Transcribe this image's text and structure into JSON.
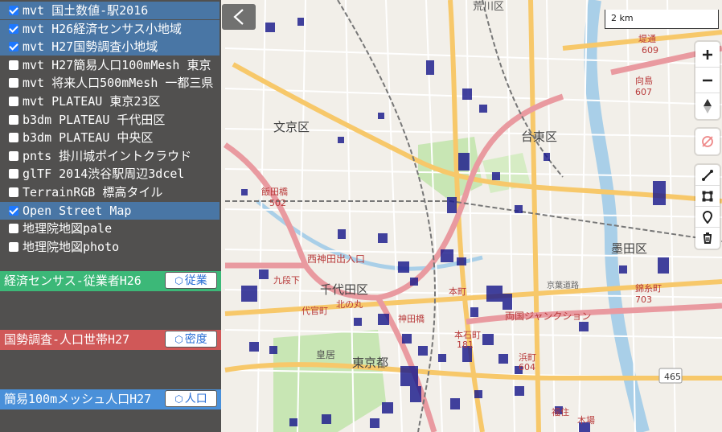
{
  "layers": [
    {
      "label": "mvt  国土数値-駅2016",
      "checked": true,
      "highlighted": true
    },
    {
      "label": "mvt  H26経済センサス小地域",
      "checked": true,
      "highlighted": true
    },
    {
      "label": "mvt  H27国勢調査小地域",
      "checked": true,
      "highlighted": true
    },
    {
      "label": "mvt  H27簡易人口100mMesh 東京",
      "checked": false,
      "highlighted": false
    },
    {
      "label": "mvt  将来人口500mMesh 一都三県",
      "checked": false,
      "highlighted": false
    },
    {
      "label": "mvt  PLATEAU 東京23区",
      "checked": false,
      "highlighted": false
    },
    {
      "label": "b3dm PLATEAU 千代田区",
      "checked": false,
      "highlighted": false
    },
    {
      "label": "b3dm PLATEAU 中央区",
      "checked": false,
      "highlighted": false
    },
    {
      "label": "pnts 掛川城ポイントクラウド",
      "checked": false,
      "highlighted": false
    },
    {
      "label": "glTF 2014渋谷駅周辺3dcel",
      "checked": false,
      "highlighted": false
    },
    {
      "label": "TerrainRGB 標高タイル",
      "checked": false,
      "highlighted": false
    },
    {
      "label": "Open Street Map",
      "checked": true,
      "highlighted": true
    },
    {
      "label": "地理院地図pale",
      "checked": false,
      "highlighted": false
    },
    {
      "label": "地理院地図photo",
      "checked": false,
      "highlighted": false
    }
  ],
  "legends": [
    {
      "title": "経済センサス-従業者H26",
      "button": "従業",
      "color": "#3cb878"
    },
    {
      "title": "国勢調査-人口世帯H27",
      "button": "密度",
      "color": "#d05858"
    },
    {
      "title": "簡易100mメッシュ人口H27",
      "button": "人口",
      "color": "#4a90d9"
    }
  ],
  "scale": {
    "label": "2 km"
  },
  "colors": {
    "accent": "#1e78ff",
    "highlight": "#4682be",
    "mesh": "#1a1a8c"
  },
  "map": {
    "place_labels": [
      {
        "text": "荒川区",
        "cls": "plc"
      },
      {
        "text": "文京区",
        "cls": "ward"
      },
      {
        "text": "台東区",
        "cls": "ward"
      },
      {
        "text": "千代田区",
        "cls": "ward"
      },
      {
        "text": "墨田区",
        "cls": "ward"
      },
      {
        "text": "東京都",
        "cls": "ward"
      },
      {
        "text": "皇居",
        "cls": "sm"
      },
      {
        "text": "飯田橋",
        "cls": "red"
      },
      {
        "text": "502",
        "cls": "red"
      },
      {
        "text": "西神田出入口",
        "cls": "red"
      },
      {
        "text": "九段下",
        "cls": "red"
      },
      {
        "text": "代官町",
        "cls": "red"
      },
      {
        "text": "北の丸",
        "cls": "red"
      },
      {
        "text": "神田橋",
        "cls": "red"
      },
      {
        "text": "本町",
        "cls": "red"
      },
      {
        "text": "本石町",
        "cls": "red"
      },
      {
        "text": "浜町",
        "cls": "red"
      },
      {
        "text": "604",
        "cls": "red"
      },
      {
        "text": "181",
        "cls": "red"
      },
      {
        "text": "両国ジャンクション",
        "cls": "red"
      },
      {
        "text": "京葉道路",
        "cls": "road"
      },
      {
        "text": "錦糸町",
        "cls": "red"
      },
      {
        "text": "703",
        "cls": "red"
      },
      {
        "text": "向島",
        "cls": "red"
      },
      {
        "text": "607",
        "cls": "red"
      },
      {
        "text": "堤通",
        "cls": "red"
      },
      {
        "text": "609",
        "cls": "red"
      },
      {
        "text": "465",
        "cls": "shield"
      },
      {
        "text": "福住",
        "cls": "red"
      },
      {
        "text": "木場",
        "cls": "red"
      }
    ]
  }
}
